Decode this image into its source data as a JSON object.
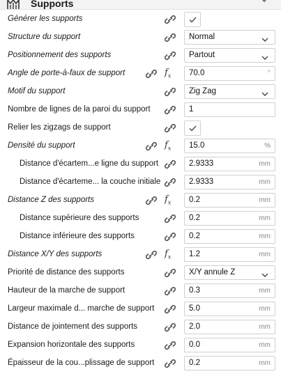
{
  "header": {
    "title": "Supports",
    "icon": "supports-section-icon"
  },
  "rows": [
    {
      "label": "Générer les supports",
      "italic": true,
      "indent": false,
      "control": "checkbox",
      "checked": true,
      "fx": false
    },
    {
      "label": "Structure du support",
      "italic": true,
      "indent": false,
      "control": "select",
      "value": "Normal",
      "fx": false
    },
    {
      "label": "Positionnement des supports",
      "italic": true,
      "indent": false,
      "control": "select",
      "value": "Partout",
      "fx": false
    },
    {
      "label": "Angle de porte-à-faux de support",
      "italic": true,
      "indent": false,
      "control": "number",
      "value": "70.0",
      "unit": "°",
      "fx": true
    },
    {
      "label": "Motif du support",
      "italic": true,
      "indent": false,
      "control": "select",
      "value": "Zig Zag",
      "fx": false
    },
    {
      "label": "Nombre de lignes de la paroi du support",
      "italic": false,
      "indent": false,
      "control": "number",
      "value": "1",
      "unit": "",
      "fx": false
    },
    {
      "label": "Relier les zigzags de support",
      "italic": false,
      "indent": false,
      "control": "checkbox",
      "checked": true,
      "fx": false
    },
    {
      "label": "Densité du support",
      "italic": true,
      "indent": false,
      "control": "number",
      "value": "15.0",
      "unit": "%",
      "fx": true
    },
    {
      "label": "Distance d'écartem...e ligne du support",
      "italic": false,
      "indent": true,
      "control": "number",
      "value": "2.9333",
      "unit": "mm",
      "fx": false
    },
    {
      "label": "Distance d'écarteme... la couche initiale",
      "italic": false,
      "indent": true,
      "control": "number",
      "value": "2.9333",
      "unit": "mm",
      "fx": false
    },
    {
      "label": "Distance Z des supports",
      "italic": true,
      "indent": false,
      "control": "number",
      "value": "0.2",
      "unit": "mm",
      "fx": true
    },
    {
      "label": "Distance supérieure des supports",
      "italic": false,
      "indent": true,
      "control": "number",
      "value": "0.2",
      "unit": "mm",
      "fx": false
    },
    {
      "label": "Distance inférieure des supports",
      "italic": false,
      "indent": true,
      "control": "number",
      "value": "0.2",
      "unit": "mm",
      "fx": false
    },
    {
      "label": "Distance X/Y des supports",
      "italic": true,
      "indent": false,
      "control": "number",
      "value": "1.2",
      "unit": "mm",
      "fx": true
    },
    {
      "label": "Priorité de distance des supports",
      "italic": false,
      "indent": false,
      "control": "select",
      "value": "X/Y annule Z",
      "fx": false
    },
    {
      "label": "Hauteur de la marche de support",
      "italic": false,
      "indent": false,
      "control": "number",
      "value": "0.3",
      "unit": "mm",
      "fx": false
    },
    {
      "label": "Largeur maximale d... marche de support",
      "italic": false,
      "indent": false,
      "control": "number",
      "value": "5.0",
      "unit": "mm",
      "fx": false
    },
    {
      "label": "Distance de jointement des supports",
      "italic": false,
      "indent": false,
      "control": "number",
      "value": "2.0",
      "unit": "mm",
      "fx": false
    },
    {
      "label": "Expansion horizontale des supports",
      "italic": false,
      "indent": false,
      "control": "number",
      "value": "0.0",
      "unit": "mm",
      "fx": false
    },
    {
      "label": "Épaisseur de la cou...plissage de support",
      "italic": false,
      "indent": false,
      "control": "number",
      "value": "0.2",
      "unit": "mm",
      "fx": false
    }
  ]
}
